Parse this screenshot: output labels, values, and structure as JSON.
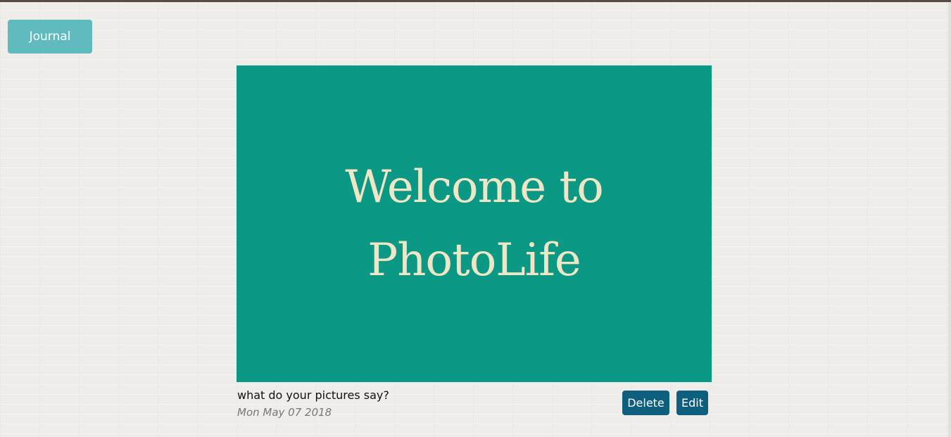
{
  "nav": {
    "journal_label": "Journal"
  },
  "entry": {
    "image_text_line1": "Welcome to",
    "image_text_line2": "PhotoLife",
    "caption": "what do your pictures say?",
    "date": "Mon May 07 2018",
    "delete_label": "Delete",
    "edit_label": "Edit"
  },
  "colors": {
    "journal_button": "#5fbbbd",
    "photo_background": "#0b9885",
    "photo_text": "#efe6c6",
    "action_button": "#0e5e7e",
    "page_background": "#efedea",
    "top_border": "#5a4a46"
  }
}
